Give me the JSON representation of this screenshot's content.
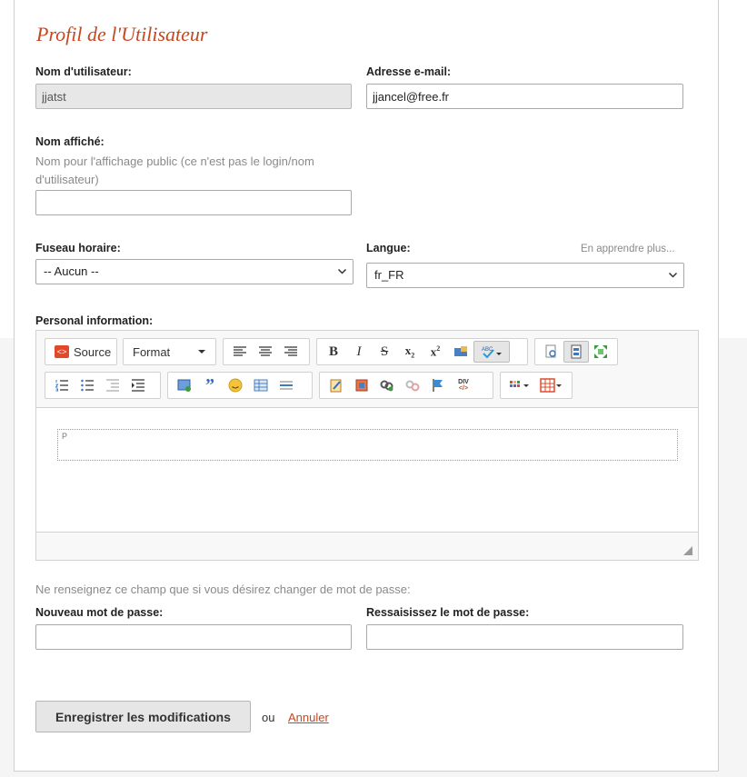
{
  "page": {
    "title": "Profil de l'Utilisateur"
  },
  "account": {
    "username_label": "Nom d'utilisateur:",
    "username_value": "jjatst",
    "email_label": "Adresse e-mail:",
    "email_value": "jjancel@free.fr"
  },
  "display_name": {
    "label": "Nom affiché:",
    "hint": "Nom pour l'affichage public (ce n'est pas le login/nom d'utilisateur)",
    "value": ""
  },
  "locale": {
    "timezone_label": "Fuseau horaire:",
    "timezone_value": "-- Aucun --",
    "language_label": "Langue:",
    "language_value": "fr_FR",
    "learn_more": "En apprendre plus..."
  },
  "editor": {
    "label": "Personal information:",
    "source_label": "Source",
    "format_label": "Format",
    "block_tag": "P"
  },
  "password": {
    "hint": "Ne renseignez ce champ que si vous désirez changer de mot de passe:",
    "new_label": "Nouveau mot de passe:",
    "confirm_label": "Ressaisissez le mot de passe:"
  },
  "actions": {
    "save_label": "Enregistrer les modifications",
    "or_label": "ou",
    "cancel_label": "Annuler"
  },
  "colors": {
    "accent": "#c7471f"
  }
}
